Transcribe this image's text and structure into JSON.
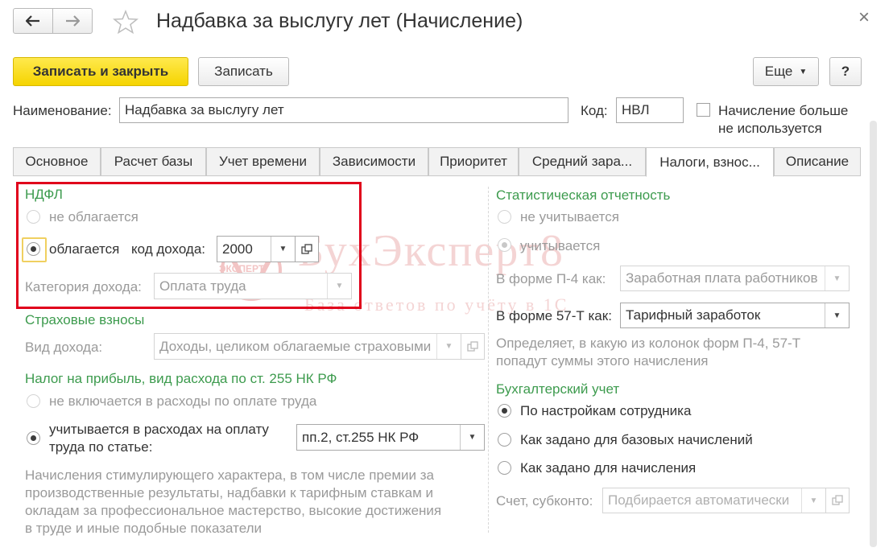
{
  "window": {
    "title": "Надбавка за выслугу лет (Начисление)",
    "close_glyph": "×"
  },
  "toolbar": {
    "save_close_label": "Записать и закрыть",
    "save_label": "Записать",
    "more_label": "Еще",
    "help_label": "?"
  },
  "header": {
    "name_label": "Наименование:",
    "name_value": "Надбавка за выслугу лет",
    "code_label": "Код:",
    "code_value": "НВЛ",
    "not_used_label_line1": "Начисление больше",
    "not_used_label_line2": "не используется",
    "not_used_checked": false
  },
  "tabs": [
    {
      "label": "Основное",
      "active": false
    },
    {
      "label": "Расчет базы",
      "active": false
    },
    {
      "label": "Учет времени",
      "active": false
    },
    {
      "label": "Зависимости",
      "active": false
    },
    {
      "label": "Приоритет",
      "active": false
    },
    {
      "label": "Средний зара...",
      "active": false
    },
    {
      "label": "Налоги, взнос...",
      "active": true
    },
    {
      "label": "Описание",
      "active": false
    }
  ],
  "ndfl": {
    "heading": "НДФЛ",
    "not_taxed_label": "не облагается",
    "taxed_label": "облагается",
    "income_code_label": "код дохода:",
    "income_code_value": "2000",
    "income_category_label": "Категория дохода:",
    "income_category_value": "Оплата труда"
  },
  "insurance": {
    "heading": "Страховые взносы",
    "income_type_label": "Вид дохода:",
    "income_type_value": "Доходы, целиком облагаемые страховыми"
  },
  "profit_tax": {
    "heading": "Налог на прибыль, вид расхода по ст. 255 НК РФ",
    "not_included_label": "не включается в расходы по оплате труда",
    "included_label_line1": "учитывается в расходах на оплату",
    "included_label_line2": "труда по статье:",
    "article_value": "пп.2, ст.255 НК РФ",
    "note_lines": [
      "Начисления стимулирующего характера, в том числе премии за",
      "производственные результаты, надбавки к тарифным ставкам и",
      "окладам за профессиональное мастерство, высокие достижения",
      "в труде и иные подобные показатели"
    ]
  },
  "statistics": {
    "heading": "Статистическая отчетность",
    "not_counted_label": "не учитывается",
    "counted_label": "учитывается",
    "p4_label": "В форме П-4 как:",
    "p4_value": "Заработная плата работников",
    "f57t_label": "В форме 57-Т как:",
    "f57t_value": "Тарифный заработок",
    "note_line1": "Определяет, в какую из колонок форм П-4, 57-Т",
    "note_line2": "попадут суммы этого начисления"
  },
  "accounting": {
    "heading": "Бухгалтерский учет",
    "option1": "По настройкам сотрудника",
    "option2": "Как задано для базовых начислений",
    "option3": "Как задано для начисления",
    "account_label": "Счет, субконто:",
    "account_placeholder": "Подбирается автоматически"
  },
  "watermark": {
    "brand": "БухЭксперт8",
    "tagline": "База ответов по учёту в 1С",
    "seal_text": "ЭКСПЕРТ"
  },
  "colors": {
    "accent_yellow": "#f5d400",
    "heading_green": "#3d9b4e",
    "highlight_red": "#e0001b"
  }
}
